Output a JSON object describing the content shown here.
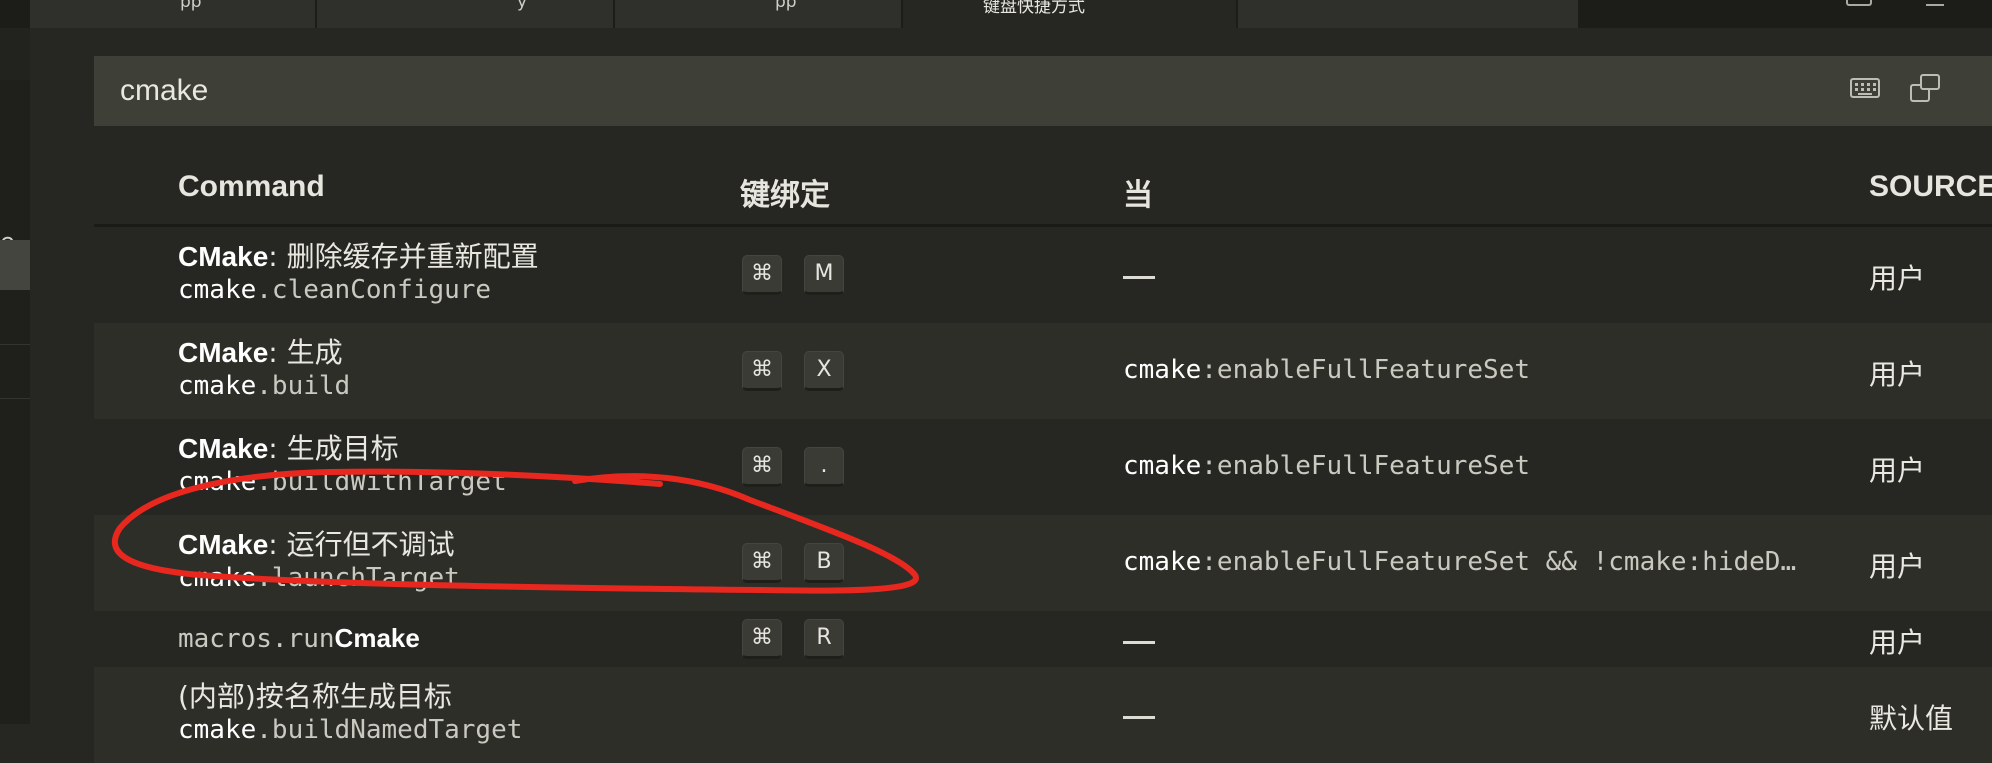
{
  "search": {
    "value": "cmake"
  },
  "toolbar": {
    "record_keys_icon": "keyboard-icon",
    "toggle_mode_icon": "record-keys-icon",
    "sort_icon": "sort-by-precedence-icon"
  },
  "columns": {
    "command": "Command",
    "keybinding": "键绑定",
    "when": "当",
    "source": "SOURCE"
  },
  "rows": [
    {
      "title_bold": "CMake",
      "title_rest": ": 删除缓存并重新配置",
      "id_bold": "cmake",
      "id_rest": ".cleanConfigure",
      "keys": [
        "⌘",
        "M"
      ],
      "when_bold": "",
      "when_rest": "",
      "when_dash": true,
      "source": "用户"
    },
    {
      "title_bold": "CMake",
      "title_rest": ": 生成",
      "id_bold": "cmake",
      "id_rest": ".build",
      "keys": [
        "⌘",
        "X"
      ],
      "when_bold": "cmake",
      "when_rest": ":enableFullFeatureSet",
      "when_dash": false,
      "source": "用户"
    },
    {
      "title_bold": "CMake",
      "title_rest": ": 生成目标",
      "id_bold": "cmake",
      "id_rest": ".buildWithTarget",
      "keys": [
        "⌘",
        "."
      ],
      "when_bold": "cmake",
      "when_rest": ":enableFullFeatureSet",
      "when_dash": false,
      "source": "用户"
    },
    {
      "title_bold": "CMake",
      "title_rest": ": 运行但不调试",
      "id_bold": "cmake",
      "id_rest": ".launchTarget",
      "keys": [
        "⌘",
        "B"
      ],
      "when_bold": "cmake",
      "when_rest": ":enableFullFeatureSet && !cmake:hideD…",
      "when_dash": false,
      "source": "用户"
    },
    {
      "id_prefix": "macros.run",
      "id_bold": "Cmake",
      "keys": [
        "⌘",
        "R"
      ],
      "when_dash": true,
      "source": "用户"
    },
    {
      "title_plain": "(内部)按名称生成目标",
      "id_bold": "cmake",
      "id_rest": ".buildNamedTarget",
      "keys": [],
      "when_dash": true,
      "source": "默认值"
    }
  ],
  "tabs": [
    {
      "label": "pp"
    },
    {
      "label": "y"
    },
    {
      "label": "pp"
    },
    {
      "label": "键盘快捷方式"
    }
  ],
  "side": {
    "letter": "e"
  },
  "colors": {
    "annotation": "#e8271f",
    "background": "#262722",
    "search_bg": "#3e3f37"
  }
}
